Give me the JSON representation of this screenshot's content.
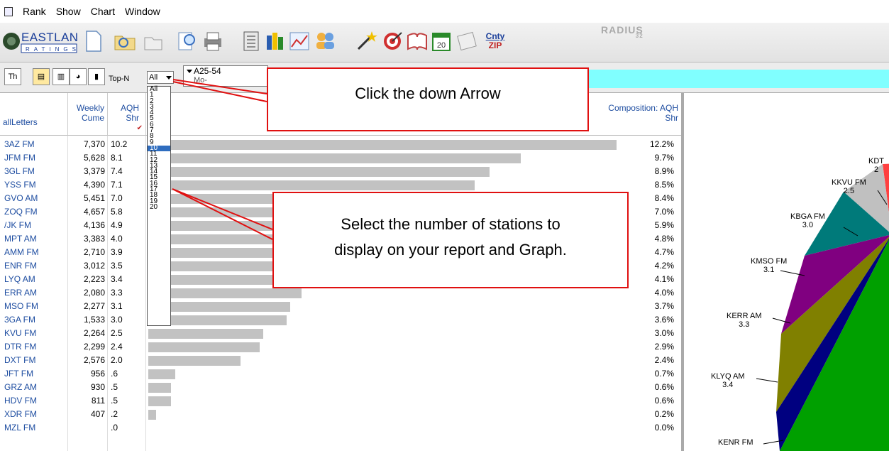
{
  "menu": {
    "items": [
      "Rank",
      "Show",
      "Chart",
      "Window"
    ]
  },
  "logo": {
    "text": "EASTLAN",
    "sub": "RATINGS"
  },
  "brand": {
    "text": "RADIUS",
    "sub": "32"
  },
  "toolbar": {
    "cnty": "Cnty",
    "zip": "ZIP",
    "calendar_day": "20"
  },
  "controls": {
    "topn_label": "Top-N",
    "topn_value": "All",
    "demo_value": "A25-54",
    "demo_sub": "Mo-"
  },
  "dropdown": {
    "options": [
      "All",
      "1",
      "2",
      "3",
      "4",
      "5",
      "6",
      "7",
      "8",
      "9",
      "10",
      "11",
      "12",
      "13",
      "14",
      "15",
      "16",
      "17",
      "18",
      "19",
      "20"
    ],
    "selected": "10"
  },
  "table": {
    "headers": {
      "call": "allLetters",
      "cume": "Weekly Cume",
      "shr": "AQH Shr",
      "comp": "Composition: AQH Shr"
    },
    "rows": [
      {
        "call": "3AZ FM",
        "cume": "7,370",
        "shr": "10.2",
        "comp": "12.2%",
        "pct": 12.2
      },
      {
        "call": "JFM FM",
        "cume": "5,628",
        "shr": "8.1",
        "comp": "9.7%",
        "pct": 9.7
      },
      {
        "call": "3GL FM",
        "cume": "3,379",
        "shr": "7.4",
        "comp": "8.9%",
        "pct": 8.9
      },
      {
        "call": "YSS FM",
        "cume": "4,390",
        "shr": "7.1",
        "comp": "8.5%",
        "pct": 8.5
      },
      {
        "call": "GVO AM",
        "cume": "5,451",
        "shr": "7.0",
        "comp": "8.4%",
        "pct": 8.4
      },
      {
        "call": "ZOQ FM",
        "cume": "4,657",
        "shr": "5.8",
        "comp": "7.0%",
        "pct": 7.0
      },
      {
        "call": "/JK FM",
        "cume": "4,136",
        "shr": "4.9",
        "comp": "5.9%",
        "pct": 5.9
      },
      {
        "call": "MPT AM",
        "cume": "3,383",
        "shr": "4.0",
        "comp": "4.8%",
        "pct": 4.8
      },
      {
        "call": "AMM FM",
        "cume": "2,710",
        "shr": "3.9",
        "comp": "4.7%",
        "pct": 4.7
      },
      {
        "call": "ENR FM",
        "cume": "3,012",
        "shr": "3.5",
        "comp": "4.2%",
        "pct": 4.2
      },
      {
        "call": "LYQ AM",
        "cume": "2,223",
        "shr": "3.4",
        "comp": "4.1%",
        "pct": 4.1
      },
      {
        "call": "ERR AM",
        "cume": "2,080",
        "shr": "3.3",
        "comp": "4.0%",
        "pct": 4.0
      },
      {
        "call": "MSO FM",
        "cume": "2,277",
        "shr": "3.1",
        "comp": "3.7%",
        "pct": 3.7
      },
      {
        "call": "3GA FM",
        "cume": "1,533",
        "shr": "3.0",
        "comp": "3.6%",
        "pct": 3.6
      },
      {
        "call": "KVU FM",
        "cume": "2,264",
        "shr": "2.5",
        "comp": "3.0%",
        "pct": 3.0
      },
      {
        "call": "DTR FM",
        "cume": "2,299",
        "shr": "2.4",
        "comp": "2.9%",
        "pct": 2.9
      },
      {
        "call": "DXT FM",
        "cume": "2,576",
        "shr": "2.0",
        "comp": "2.4%",
        "pct": 2.4
      },
      {
        "call": "JFT FM",
        "cume": "956",
        "shr": ".6",
        "comp": "0.7%",
        "pct": 0.7
      },
      {
        "call": "GRZ AM",
        "cume": "930",
        "shr": ".5",
        "comp": "0.6%",
        "pct": 0.6
      },
      {
        "call": "HDV FM",
        "cume": "811",
        "shr": ".5",
        "comp": "0.6%",
        "pct": 0.6
      },
      {
        "call": "XDR FM",
        "cume": "407",
        "shr": ".2",
        "comp": "0.2%",
        "pct": 0.2
      },
      {
        "call": "MZL FM",
        "cume": "",
        "shr": ".0",
        "comp": "0.0%",
        "pct": 0.0
      }
    ]
  },
  "callouts": {
    "first": "Click the down Arrow",
    "second_line1": "Select the number of stations to",
    "second_line2": "display on your report and Graph."
  },
  "pie": {
    "labels": [
      {
        "name": "KDT",
        "value": "2"
      },
      {
        "name": "KKVU FM",
        "value": "2.5"
      },
      {
        "name": "KBGA FM",
        "value": "3.0"
      },
      {
        "name": "KMSO FM",
        "value": "3.1"
      },
      {
        "name": "KERR AM",
        "value": "3.3"
      },
      {
        "name": "KLYQ AM",
        "value": "3.4"
      },
      {
        "name": "KENR FM",
        "value": ""
      }
    ],
    "colors": [
      "#ff4040",
      "#c0c0c0",
      "#007a7a",
      "#800080",
      "#808000",
      "#000080",
      "#009000"
    ]
  }
}
